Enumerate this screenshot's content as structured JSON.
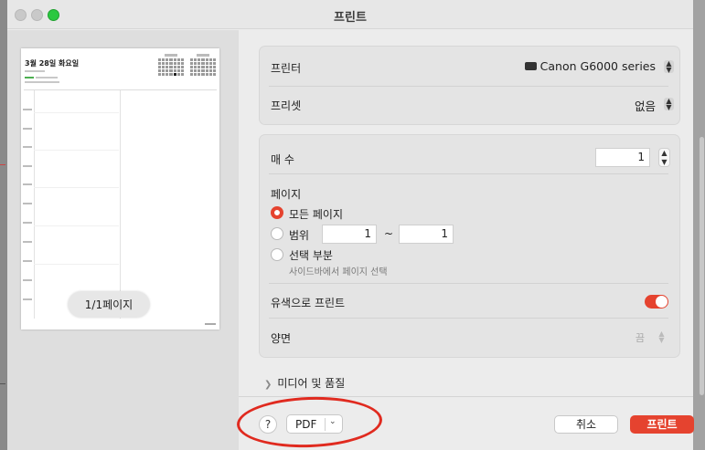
{
  "window": {
    "title": "프린트"
  },
  "preview": {
    "page_title": "3월 28일 화요일",
    "page_indicator": "1/1페이지"
  },
  "settings": {
    "printer": {
      "label": "프린터",
      "value": "Canon G6000 series"
    },
    "preset": {
      "label": "프리셋",
      "value": "없음"
    },
    "copies": {
      "label": "매 수",
      "value": "1"
    },
    "pages": {
      "label": "페이지",
      "all_label": "모든 페이지",
      "range_label": "범위",
      "range_from": "1",
      "range_to": "1",
      "range_sep": "~",
      "selection_label": "선택 부분",
      "selection_sub": "사이드바에서 페이지 선택",
      "selected": "all"
    },
    "color": {
      "label": "유색으로 프린트",
      "on": true
    },
    "duplex": {
      "label": "양면",
      "value": "끔"
    },
    "media": {
      "label": "미디어 및 품질"
    }
  },
  "buttons": {
    "help": "?",
    "pdf": "PDF",
    "cancel": "취소",
    "print": "프린트"
  },
  "colors": {
    "accent": "#e5432f",
    "annotation": "#e02a1f"
  }
}
